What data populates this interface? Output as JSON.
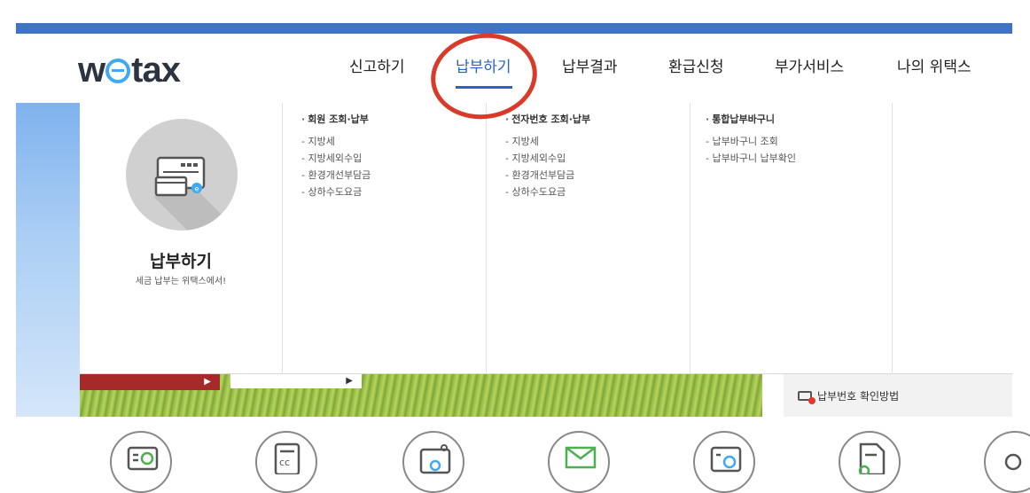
{
  "brand": {
    "logo_text_pre": "w",
    "logo_text_post": "tax"
  },
  "nav": {
    "items": [
      {
        "label": "신고하기"
      },
      {
        "label": "납부하기"
      },
      {
        "label": "납부결과"
      },
      {
        "label": "환급신청"
      },
      {
        "label": "부가서비스"
      },
      {
        "label": "나의 위택스"
      }
    ],
    "active_index": 1
  },
  "mega_menu": {
    "feature": {
      "title": "납부하기",
      "subtitle": "세금 납부는 위택스에서!",
      "icon": "payment-card-icon"
    },
    "columns": [
      {
        "title": "회원 조회·납부",
        "links": [
          "- 지방세",
          "- 지방세외수입",
          "- 환경개선부담금",
          "- 상하수도요금"
        ]
      },
      {
        "title": "전자번호 조회·납부",
        "links": [
          "- 지방세",
          "- 지방세외수입",
          "- 환경개선부담금",
          "- 상하수도요금"
        ]
      },
      {
        "title": "통합납부바구니",
        "links": [
          "- 납부바구니 조회",
          "- 납부바구니 납부확인"
        ]
      }
    ]
  },
  "banner": {
    "arrow": "▶"
  },
  "side": {
    "link_label": "납부번호 확인방법",
    "icon": "card-alert-icon"
  },
  "quick_icons": [
    "e-payment-icon",
    "cc-card-icon",
    "monitor-icon",
    "mail-icon",
    "document-search-icon",
    "file-check-icon",
    "partial-icon"
  ],
  "colors": {
    "accent": "#2a62c9",
    "top_bar": "#3f73c4",
    "annotation": "#d93b2b",
    "banner_red": "#a62a2a"
  }
}
